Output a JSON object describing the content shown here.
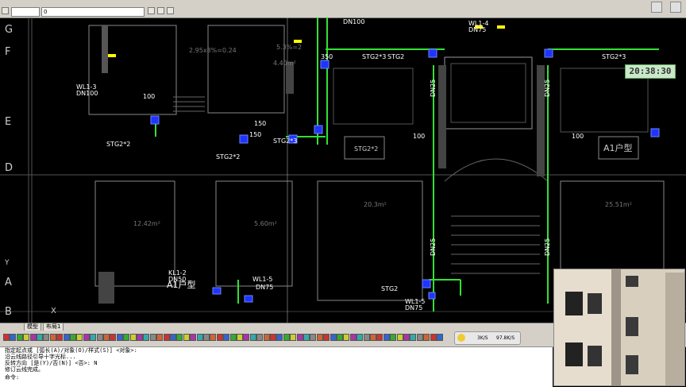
{
  "toolbar": {
    "layer_combo_value": "0",
    "layer_combo2_value": ""
  },
  "tabs": [
    {
      "label": "模型"
    },
    {
      "label": "布局1"
    }
  ],
  "network": {
    "up": "3K/S",
    "down": "97.8K/S"
  },
  "clock": "20:38:30",
  "grid_labels": [
    "G",
    "F",
    "E",
    "D",
    "A",
    "B"
  ],
  "axis_labels": {
    "x": "X",
    "y": "Y"
  },
  "drawing": {
    "texts": [
      {
        "t": "DN100"
      },
      {
        "t": "WL1-4"
      },
      {
        "t": "DN75"
      },
      {
        "t": "WL1-3"
      },
      {
        "t": "DN100"
      },
      {
        "t": "STG2*3"
      },
      {
        "t": "STG2"
      },
      {
        "t": "STG2*3"
      },
      {
        "t": "STG2*2"
      },
      {
        "t": "STG2*2"
      },
      {
        "t": "STG2*3"
      },
      {
        "t": "STG2*2"
      },
      {
        "t": "A1户型"
      },
      {
        "t": "A1户型"
      },
      {
        "t": "KL1-2"
      },
      {
        "t": "DN50"
      },
      {
        "t": "WL1-5"
      },
      {
        "t": "DN75"
      },
      {
        "t": "STG2"
      },
      {
        "t": "WL1-5"
      },
      {
        "t": "DN75"
      },
      {
        "t": "DN25"
      },
      {
        "t": "DN25"
      },
      {
        "t": "DN25"
      },
      {
        "t": "DN25"
      },
      {
        "t": "2.95x8%=0.24"
      },
      {
        "t": "5.3%=2"
      },
      {
        "t": "12.42m²"
      },
      {
        "t": "5.60m²"
      },
      {
        "t": "20.3m²"
      },
      {
        "t": "25.51m²"
      },
      {
        "t": "4.40m²"
      },
      {
        "t": "350"
      },
      {
        "t": "100"
      },
      {
        "t": "150"
      },
      {
        "t": "100"
      },
      {
        "t": "150"
      },
      {
        "t": "100"
      }
    ]
  },
  "command_lines": [
    "指定起点或 [弧长(A)/对象(O)/样式(S)] <对象>:",
    "沿云线路径引导十字光标...",
    "反转方向 [是(Y)/否(N)] <否>: N",
    "修订云线完成。",
    "命令:"
  ]
}
